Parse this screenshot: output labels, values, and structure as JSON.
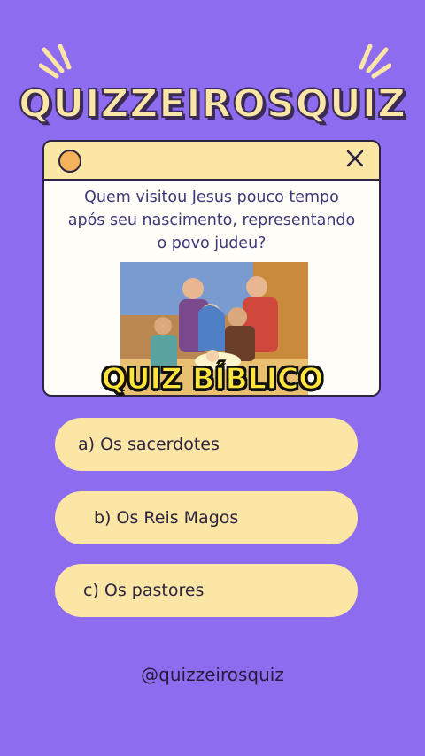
{
  "header": {
    "title": "QUIZZEIROSQUIZ"
  },
  "card": {
    "question": "Quem visitou Jesus pouco tempo após seu nascimento, representando o povo judeu?",
    "image_label": "nativity-scene"
  },
  "badge": {
    "text": "QUIZ BÍBLICO"
  },
  "options": [
    {
      "label": "a) Os sacerdotes"
    },
    {
      "label": "b) Os Reis Magos"
    },
    {
      "label": "c) Os pastores"
    }
  ],
  "footer": {
    "handle": "@quizzeirosquiz"
  },
  "colors": {
    "background": "#8e6cf0",
    "cream": "#fbe6a6",
    "dark": "#2c2440",
    "question_text": "#3e3778",
    "badge_yellow": "#ffe53b"
  }
}
